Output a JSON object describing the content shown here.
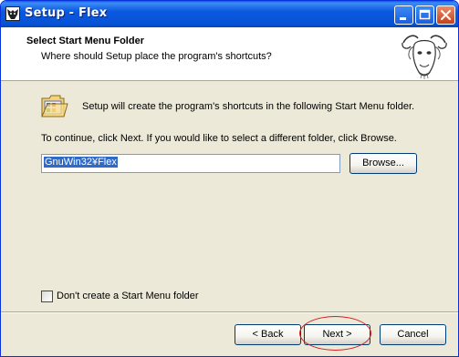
{
  "window": {
    "title": "Setup - Flex",
    "minimize_label": "Minimize",
    "maximize_label": "Maximize",
    "close_label": "Close"
  },
  "header": {
    "title": "Select Start Menu Folder",
    "subtitle": "Where should Setup place the program's shortcuts?"
  },
  "body": {
    "info_text": "Setup will create the program's shortcuts in the following Start Menu folder.",
    "continue_text": "To continue, click Next. If you would like to select a different folder, click Browse.",
    "folder_value": "GnuWin32¥Flex",
    "browse_label": "Browse...",
    "checkbox_label": "Don't create a Start Menu folder",
    "checkbox_checked": false
  },
  "footer": {
    "back_label": "< Back",
    "next_label": "Next >",
    "cancel_label": "Cancel"
  },
  "colors": {
    "titlebar": "#0a58df",
    "dialog_bg": "#ece9d8",
    "highlight_ring": "#d32020"
  }
}
